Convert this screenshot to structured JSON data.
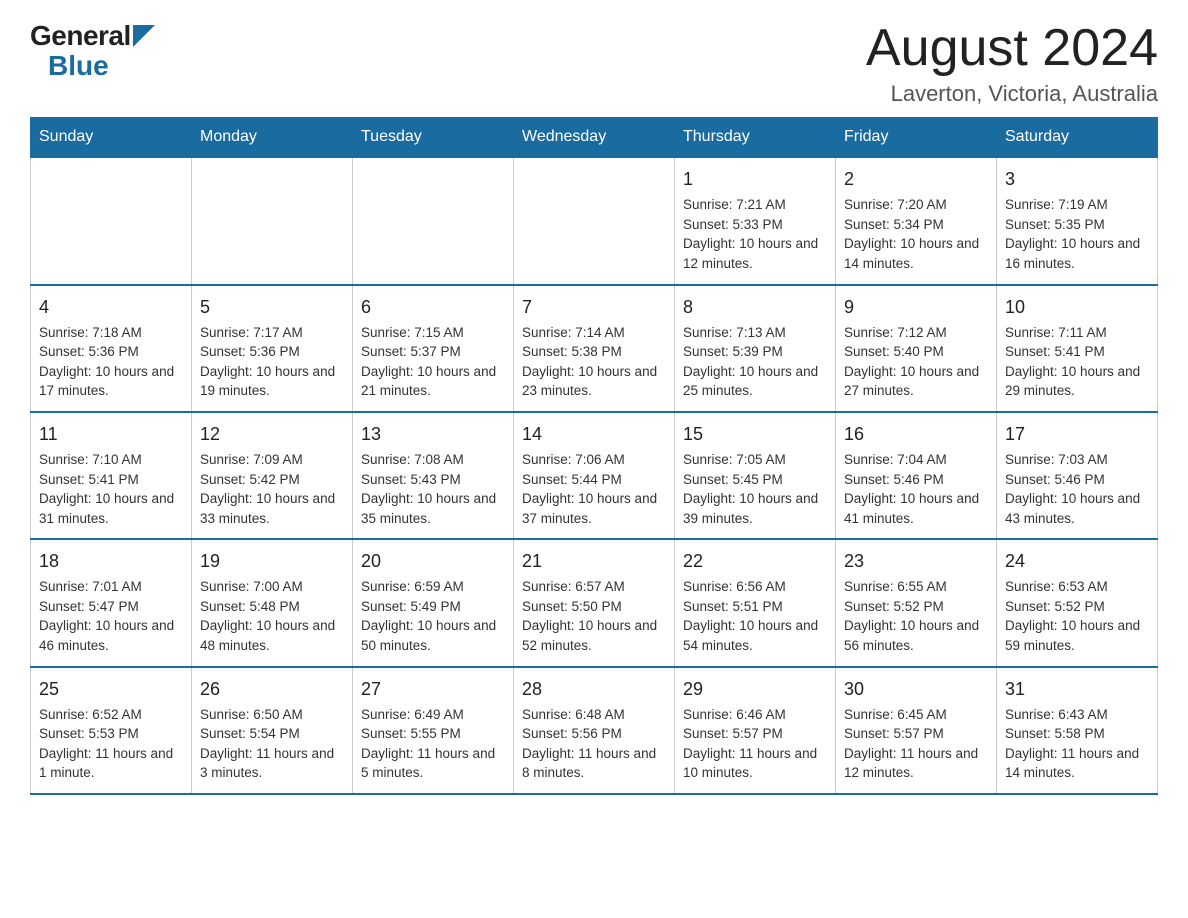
{
  "header": {
    "logo_general": "General",
    "logo_blue": "Blue",
    "month_title": "August 2024",
    "location": "Laverton, Victoria, Australia"
  },
  "days_of_week": [
    "Sunday",
    "Monday",
    "Tuesday",
    "Wednesday",
    "Thursday",
    "Friday",
    "Saturday"
  ],
  "weeks": [
    [
      {
        "day": "",
        "info": ""
      },
      {
        "day": "",
        "info": ""
      },
      {
        "day": "",
        "info": ""
      },
      {
        "day": "",
        "info": ""
      },
      {
        "day": "1",
        "info": "Sunrise: 7:21 AM\nSunset: 5:33 PM\nDaylight: 10 hours and 12 minutes."
      },
      {
        "day": "2",
        "info": "Sunrise: 7:20 AM\nSunset: 5:34 PM\nDaylight: 10 hours and 14 minutes."
      },
      {
        "day": "3",
        "info": "Sunrise: 7:19 AM\nSunset: 5:35 PM\nDaylight: 10 hours and 16 minutes."
      }
    ],
    [
      {
        "day": "4",
        "info": "Sunrise: 7:18 AM\nSunset: 5:36 PM\nDaylight: 10 hours and 17 minutes."
      },
      {
        "day": "5",
        "info": "Sunrise: 7:17 AM\nSunset: 5:36 PM\nDaylight: 10 hours and 19 minutes."
      },
      {
        "day": "6",
        "info": "Sunrise: 7:15 AM\nSunset: 5:37 PM\nDaylight: 10 hours and 21 minutes."
      },
      {
        "day": "7",
        "info": "Sunrise: 7:14 AM\nSunset: 5:38 PM\nDaylight: 10 hours and 23 minutes."
      },
      {
        "day": "8",
        "info": "Sunrise: 7:13 AM\nSunset: 5:39 PM\nDaylight: 10 hours and 25 minutes."
      },
      {
        "day": "9",
        "info": "Sunrise: 7:12 AM\nSunset: 5:40 PM\nDaylight: 10 hours and 27 minutes."
      },
      {
        "day": "10",
        "info": "Sunrise: 7:11 AM\nSunset: 5:41 PM\nDaylight: 10 hours and 29 minutes."
      }
    ],
    [
      {
        "day": "11",
        "info": "Sunrise: 7:10 AM\nSunset: 5:41 PM\nDaylight: 10 hours and 31 minutes."
      },
      {
        "day": "12",
        "info": "Sunrise: 7:09 AM\nSunset: 5:42 PM\nDaylight: 10 hours and 33 minutes."
      },
      {
        "day": "13",
        "info": "Sunrise: 7:08 AM\nSunset: 5:43 PM\nDaylight: 10 hours and 35 minutes."
      },
      {
        "day": "14",
        "info": "Sunrise: 7:06 AM\nSunset: 5:44 PM\nDaylight: 10 hours and 37 minutes."
      },
      {
        "day": "15",
        "info": "Sunrise: 7:05 AM\nSunset: 5:45 PM\nDaylight: 10 hours and 39 minutes."
      },
      {
        "day": "16",
        "info": "Sunrise: 7:04 AM\nSunset: 5:46 PM\nDaylight: 10 hours and 41 minutes."
      },
      {
        "day": "17",
        "info": "Sunrise: 7:03 AM\nSunset: 5:46 PM\nDaylight: 10 hours and 43 minutes."
      }
    ],
    [
      {
        "day": "18",
        "info": "Sunrise: 7:01 AM\nSunset: 5:47 PM\nDaylight: 10 hours and 46 minutes."
      },
      {
        "day": "19",
        "info": "Sunrise: 7:00 AM\nSunset: 5:48 PM\nDaylight: 10 hours and 48 minutes."
      },
      {
        "day": "20",
        "info": "Sunrise: 6:59 AM\nSunset: 5:49 PM\nDaylight: 10 hours and 50 minutes."
      },
      {
        "day": "21",
        "info": "Sunrise: 6:57 AM\nSunset: 5:50 PM\nDaylight: 10 hours and 52 minutes."
      },
      {
        "day": "22",
        "info": "Sunrise: 6:56 AM\nSunset: 5:51 PM\nDaylight: 10 hours and 54 minutes."
      },
      {
        "day": "23",
        "info": "Sunrise: 6:55 AM\nSunset: 5:52 PM\nDaylight: 10 hours and 56 minutes."
      },
      {
        "day": "24",
        "info": "Sunrise: 6:53 AM\nSunset: 5:52 PM\nDaylight: 10 hours and 59 minutes."
      }
    ],
    [
      {
        "day": "25",
        "info": "Sunrise: 6:52 AM\nSunset: 5:53 PM\nDaylight: 11 hours and 1 minute."
      },
      {
        "day": "26",
        "info": "Sunrise: 6:50 AM\nSunset: 5:54 PM\nDaylight: 11 hours and 3 minutes."
      },
      {
        "day": "27",
        "info": "Sunrise: 6:49 AM\nSunset: 5:55 PM\nDaylight: 11 hours and 5 minutes."
      },
      {
        "day": "28",
        "info": "Sunrise: 6:48 AM\nSunset: 5:56 PM\nDaylight: 11 hours and 8 minutes."
      },
      {
        "day": "29",
        "info": "Sunrise: 6:46 AM\nSunset: 5:57 PM\nDaylight: 11 hours and 10 minutes."
      },
      {
        "day": "30",
        "info": "Sunrise: 6:45 AM\nSunset: 5:57 PM\nDaylight: 11 hours and 12 minutes."
      },
      {
        "day": "31",
        "info": "Sunrise: 6:43 AM\nSunset: 5:58 PM\nDaylight: 11 hours and 14 minutes."
      }
    ]
  ]
}
